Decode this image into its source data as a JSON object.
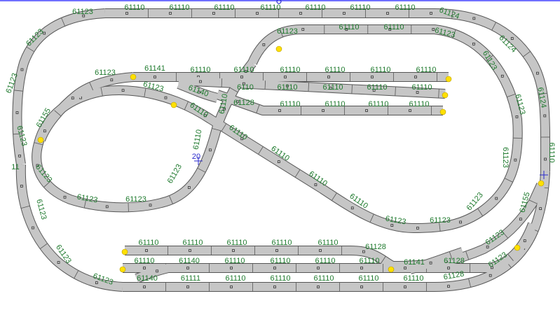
{
  "layout": {
    "title": "",
    "colors": {
      "background": "#ffffff",
      "track_fill": "#c6c6c6",
      "track_edge": "#555555",
      "label": "#1f7a2e",
      "switch_end": "#ffe000",
      "top_rule": "#4040ff",
      "marker": "#2a2acc"
    },
    "labels": {
      "t1": "61123",
      "t2": "61110",
      "t3": "61110",
      "t4": "61110",
      "t5": "61110",
      "t6": "61110",
      "t7": "61110",
      "t8": "61110",
      "t9": "61124",
      "l1": "61123",
      "l2": "61123",
      "l3": "61123",
      "l4": "61123",
      "l5": "11",
      "l6": "61123",
      "l7": "61123",
      "l8": "61123",
      "l9": "61155",
      "r1": "61124",
      "r2": "61123",
      "r3": "61123",
      "r4": "61124",
      "r5": "61110",
      "r6": "61123",
      "r7": "61123",
      "r8": "61155",
      "u1": "61123",
      "u2": "61110",
      "u3": "61110",
      "u4": "61123",
      "m1": "61123",
      "m2": "61141",
      "m3": "61110",
      "m4": "61110",
      "m5": "61110",
      "m6": "61110",
      "m7": "61110",
      "m8": "61110",
      "m9": "61123",
      "m10": "61140",
      "m11": "6110",
      "m12": "61110",
      "m13": "61110",
      "m14": "61110",
      "m15": "61110",
      "m16": "61110",
      "m17": "61110",
      "m18": "61128",
      "m19": "61110",
      "m20": "61110",
      "m21": "61110",
      "m22": "61110",
      "f1": "61110",
      "f2": "61110",
      "f3": "61110",
      "f4": "61110",
      "f5": "61123",
      "f6": "61123",
      "f7": "61123",
      "f8": "61123",
      "f9": "61123",
      "f10": "61110",
      "f11": "61110",
      "f12": "61110",
      "f13": "61110",
      "f14": "61123",
      "f15": "61123",
      "b1": "61110",
      "b2": "61110",
      "b3": "61110",
      "b4": "61110",
      "b5": "61110",
      "b6": "61128",
      "b7": "61110",
      "b8": "61140",
      "b9": "61110",
      "b10": "61110",
      "b11": "61110",
      "b12": "61110",
      "b13": "61110",
      "b14": "61141",
      "b15": "61128",
      "b16": "61123",
      "b17": "61140",
      "b18": "61111",
      "b19": "61110",
      "b20": "61110",
      "b21": "61110",
      "b22": "61110",
      "b23": "61110",
      "b24": "61110",
      "b25": "61128",
      "b26": "61123",
      "marker": "20"
    }
  }
}
